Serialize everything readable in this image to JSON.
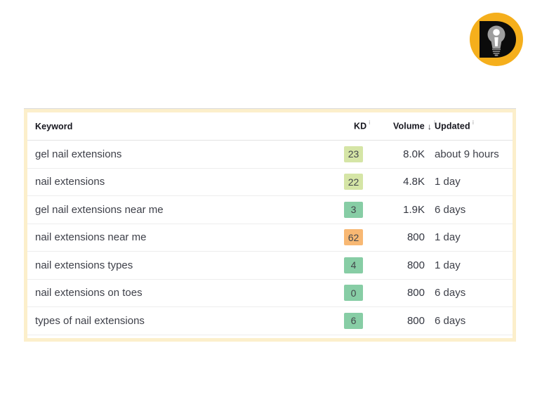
{
  "page": {
    "background": "#ffffff"
  },
  "logo": {
    "description": "lightbulb letter-D logo in yellow circle",
    "circle_color": "#F5AF1C",
    "letter_color": "#0B0B0B",
    "bulb_color": "#9E9E9E",
    "dot_color": "#FFFFFF"
  },
  "table": {
    "border_color": "#FCEFCB",
    "divider_color": "#EDEDED",
    "sort_arrow": "↓",
    "info_glyph": "i",
    "columns": [
      {
        "key": "keyword",
        "label": "Keyword",
        "info": false
      },
      {
        "key": "kd",
        "label": "KD",
        "info": true
      },
      {
        "key": "volume",
        "label": "Volume",
        "info": true,
        "sorted": "desc"
      },
      {
        "key": "updated",
        "label": "Updated",
        "info": true
      }
    ],
    "kd_colors": {
      "easy": "#87CDA5",
      "medium": "#D5E5A6",
      "hard": "#F8B873"
    },
    "rows": [
      {
        "keyword": "gel nail extensions",
        "kd": "23",
        "kd_level": "medium",
        "volume": "8.0K",
        "updated": "about 9 hours"
      },
      {
        "keyword": "nail extensions",
        "kd": "22",
        "kd_level": "medium",
        "volume": "4.8K",
        "updated": "1 day"
      },
      {
        "keyword": "gel nail extensions near me",
        "kd": "3",
        "kd_level": "easy",
        "volume": "1.9K",
        "updated": "6 days"
      },
      {
        "keyword": "nail extensions near me",
        "kd": "62",
        "kd_level": "hard",
        "volume": "800",
        "updated": "1 day"
      },
      {
        "keyword": "nail extensions types",
        "kd": "4",
        "kd_level": "easy",
        "volume": "800",
        "updated": "1 day"
      },
      {
        "keyword": "nail extensions on toes",
        "kd": "0",
        "kd_level": "easy",
        "volume": "800",
        "updated": "6 days"
      },
      {
        "keyword": "types of nail extensions",
        "kd": "6",
        "kd_level": "easy",
        "volume": "800",
        "updated": "6 days"
      }
    ]
  }
}
